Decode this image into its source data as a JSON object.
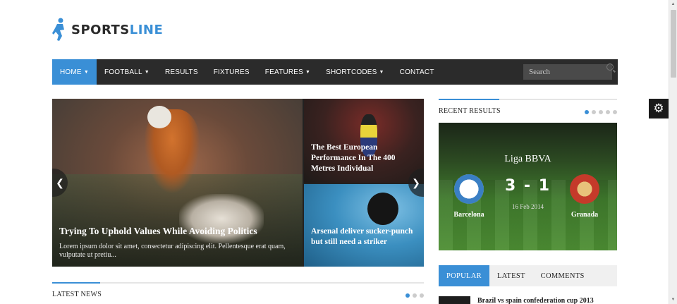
{
  "logo": {
    "part1": "SPORTS",
    "part2": "LINE"
  },
  "nav": {
    "items": [
      {
        "label": "HOME",
        "dropdown": true,
        "active": true
      },
      {
        "label": "FOOTBALL",
        "dropdown": true
      },
      {
        "label": "RESULTS",
        "dropdown": false
      },
      {
        "label": "FIXTURES",
        "dropdown": false
      },
      {
        "label": "FEATURES",
        "dropdown": true
      },
      {
        "label": "SHORTCODES",
        "dropdown": true
      },
      {
        "label": "CONTACT",
        "dropdown": false
      }
    ],
    "search_placeholder": "Search"
  },
  "slider": {
    "main_title": "Trying To Uphold Values While Avoiding Politics",
    "main_desc": "Lorem ipsum dolor sit amet, consectetur adipiscing elit. Pellentesque erat quam, vulputate ut pretiu...",
    "side_top_title": "The Best European Performance In The 400 Metres Individual",
    "side_bottom_title": "Arsenal deliver sucker-punch but still need a striker",
    "prev_glyph": "❮",
    "next_glyph": "❯"
  },
  "latest_news": {
    "label": "LATEST NEWS"
  },
  "recent_results": {
    "label": "RECENT RESULTS",
    "league": "Liga BBVA",
    "score": "3 - 1",
    "date": "16 Feb 2014",
    "home_team": "Barcelona",
    "away_team": "Granada"
  },
  "tabs": [
    "POPULAR",
    "LATEST",
    "COMMENTS"
  ],
  "popular_first_title": "Brazil vs spain confederation cup 2013",
  "colors": {
    "accent": "#3a8fd6",
    "nav_bg": "#2b2b2b"
  },
  "icons": {
    "settings": "gear-icon",
    "search": "search-icon"
  }
}
